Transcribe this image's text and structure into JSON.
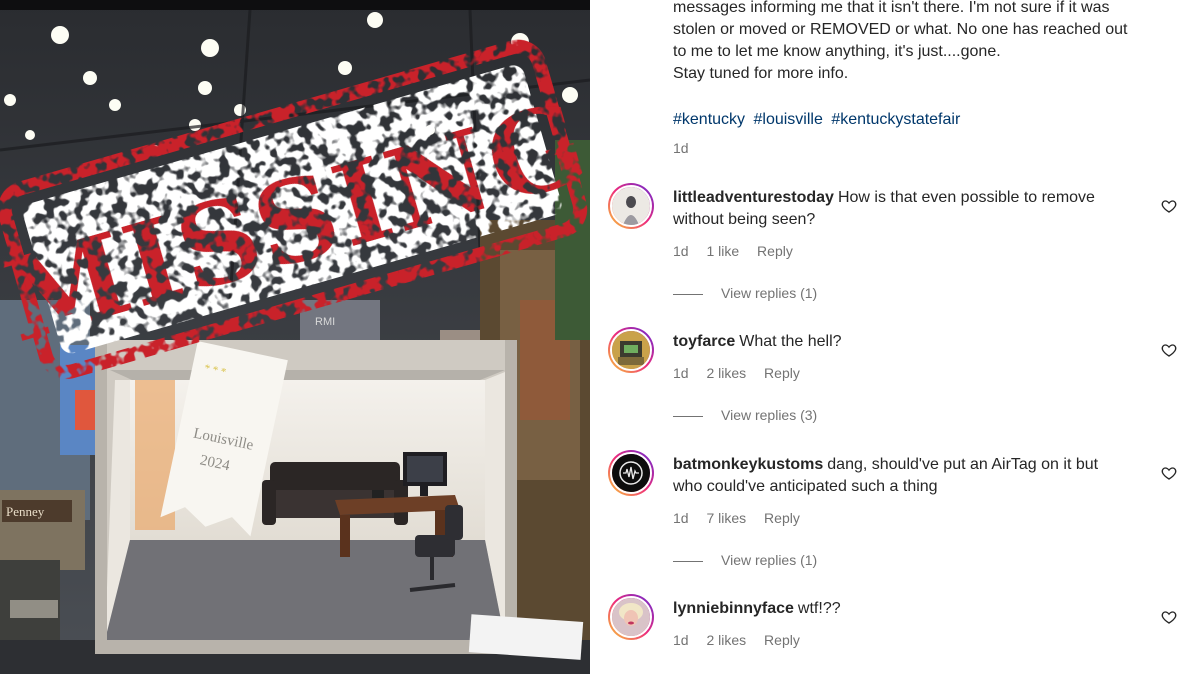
{
  "media": {
    "stamp_text": "MISSING",
    "ribbon_line1": "Louisville",
    "ribbon_line2": "2024",
    "store_sign": "Penney",
    "booth_sign": "RMI",
    "colors": {
      "stamp_red": "#c9202a",
      "floor": "#6c6c70",
      "wall": "#f2efe9"
    }
  },
  "post": {
    "caption_lines": [
      "messages informing me that it isn't there. I'm not sure if it was",
      "stolen or moved or REMOVED or what. No one has reached out",
      "to me to let me know anything, it's just....gone.",
      "Stay tuned for more info."
    ],
    "hashtags": [
      "#kentucky",
      "#louisville",
      "#kentuckystatefair"
    ],
    "age": "1d"
  },
  "comments": [
    {
      "username": "littleadventurestoday",
      "text": "How is that even possible to remove",
      "text_line2": "without being seen?",
      "age": "1d",
      "likes": "1 like",
      "reply_label": "Reply",
      "view_replies": "View replies (1)",
      "avatar_icon": "avatar-photo-icon"
    },
    {
      "username": "toyfarce",
      "text": "What the hell?",
      "text_line2": "",
      "age": "1d",
      "likes": "2 likes",
      "reply_label": "Reply",
      "view_replies": "View replies (3)",
      "avatar_icon": "avatar-photo-icon"
    },
    {
      "username": "batmonkeykustoms",
      "text": "dang, should've put an AirTag on it but",
      "text_line2": "who could've anticipated such a thing",
      "age": "1d",
      "likes": "7 likes",
      "reply_label": "Reply",
      "view_replies": "View replies (1)",
      "avatar_icon": "avatar-logo-icon"
    },
    {
      "username": "lynniebinnyface",
      "text": "wtf!??",
      "text_line2": "",
      "age": "1d",
      "likes": "2 likes",
      "reply_label": "Reply",
      "view_replies": "",
      "avatar_icon": "avatar-photo-icon"
    }
  ],
  "colors": {
    "link": "#00376b",
    "muted": "#737373",
    "text": "#262626"
  }
}
